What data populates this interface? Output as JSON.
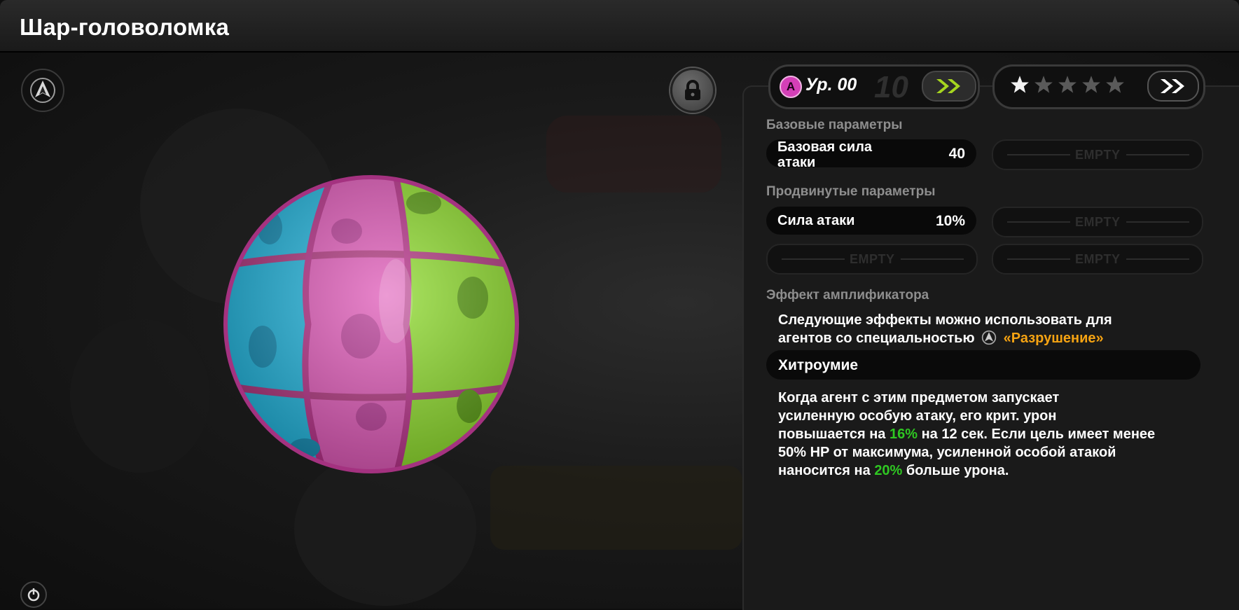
{
  "window": {
    "title": "Шар-головоломка"
  },
  "level": {
    "rank_letter": "A",
    "label": "Ур. 00",
    "max": "10"
  },
  "stars": {
    "total": 5,
    "filled": 1
  },
  "sections": {
    "base": "Базовые параметры",
    "advanced": "Продвинутые параметры",
    "amplifier": "Эффект амплификатора"
  },
  "base_stat": {
    "name_line1": "Базовая сила",
    "name_line2": "атаки",
    "value": "40"
  },
  "advanced_stat": {
    "name": "Сила атаки",
    "value": "10%"
  },
  "empty_label": "EMPTY",
  "amplifier": {
    "intro_line1": "Следующие эффекты можно использовать для",
    "intro_line2": "агентов со специальностью",
    "specialty": "«Разрушение»",
    "effect_name": "Хитроумие",
    "desc_1": "Когда агент с этим предметом запускает",
    "desc_2": "усиленную особую атаку, его крит. урон",
    "desc_3a": "повышается на",
    "desc_3b": "16%",
    "desc_3c": "на 12 сек. Если цель имеет менее",
    "desc_4": "50% HP от максимума, усиленной особой атакой",
    "desc_5a": "наносится на",
    "desc_5b": "20%",
    "desc_5c": "больше урона."
  },
  "icons": {
    "faction": "faction-emblem-icon",
    "lock": "lock-icon",
    "power": "power-icon",
    "level_up": "double-chevron-icon",
    "stars_up": "double-chevron-icon"
  },
  "colors": {
    "accent_orange": "#f5a312",
    "accent_green": "#2fc722",
    "rank_pink": "#d43fb7",
    "chevron_green": "#a6d51f"
  }
}
